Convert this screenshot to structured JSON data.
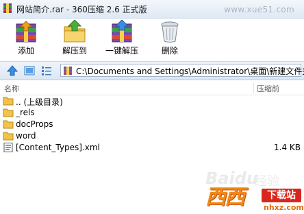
{
  "window": {
    "title": "网站简介.rar - 360压缩 2.6 正式版",
    "watermark": "www.xue51.com"
  },
  "toolbar": {
    "add_label": "添加",
    "extract_to_label": "解压到",
    "one_click_extract_label": "一键解压",
    "delete_label": "删除"
  },
  "address": {
    "path": "C:\\Documents and Settings\\Administrator\\桌面\\新建文件夹\\"
  },
  "list": {
    "headers": {
      "name": "名称",
      "size": "压缩前"
    },
    "rows": [
      {
        "name": ".. (上级目录)",
        "size": "",
        "icon": "folder-icon"
      },
      {
        "name": "_rels",
        "size": "",
        "icon": "folder-icon"
      },
      {
        "name": "docProps",
        "size": "",
        "icon": "folder-icon"
      },
      {
        "name": "word",
        "size": "",
        "icon": "folder-icon"
      },
      {
        "name": "[Content_Types].xml",
        "size": "1.4 KB",
        "icon": "xml-file-icon"
      }
    ]
  },
  "watermarks": {
    "baidu": "Baidu",
    "jingyan": "经验",
    "logo": "西西",
    "download_badge": "下载站",
    "site": "nhxz.com"
  },
  "colors": {
    "titlebar": "#dfe9f4",
    "addressbar": "#dce7f3",
    "folder": "#f2c24a",
    "accent_blue": "#2f7fd0"
  }
}
